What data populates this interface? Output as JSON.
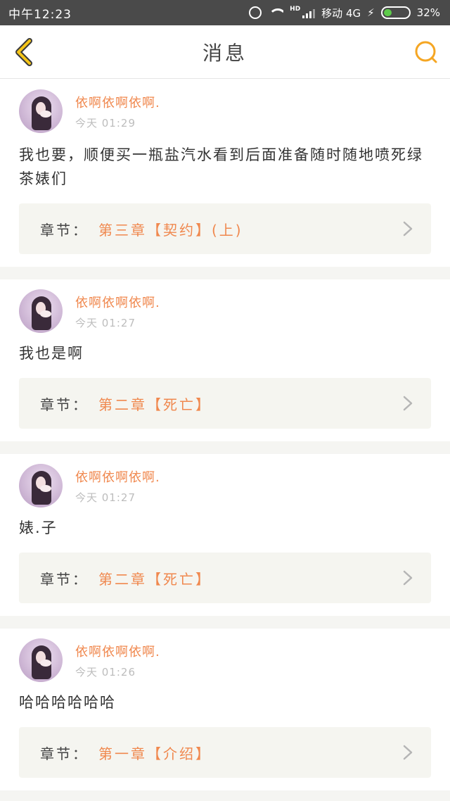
{
  "status_bar": {
    "time": "中午12:23",
    "carrier": "移动 4G",
    "hd": "HD",
    "battery": "32%",
    "battery_level": 0.32
  },
  "nav": {
    "title": "消息",
    "back_icon": "chevron-left-icon",
    "search_icon": "search-icon",
    "accent": "#f5a623"
  },
  "colors": {
    "name": "#f0884e",
    "chapter": "#f0884e",
    "card_bg": "#f5f5f0",
    "separator": "#f5f5f2"
  },
  "chapter_label": "章节：",
  "messages": [
    {
      "user": "依啊依啊依啊.",
      "time": "今天 01:29",
      "text": "我也要，顺便买一瓶盐汽水看到后面准备随时随地喷死绿茶婊们",
      "chapter": "第三章【契约】(上)"
    },
    {
      "user": "依啊依啊依啊.",
      "time": "今天 01:27",
      "text": "我也是啊",
      "chapter": "第二章【死亡】"
    },
    {
      "user": "依啊依啊依啊.",
      "time": "今天 01:27",
      "text": "婊.子",
      "chapter": "第二章【死亡】"
    },
    {
      "user": "依啊依啊依啊.",
      "time": "今天 01:26",
      "text": "哈哈哈哈哈哈",
      "chapter": "第一章【介绍】"
    }
  ]
}
